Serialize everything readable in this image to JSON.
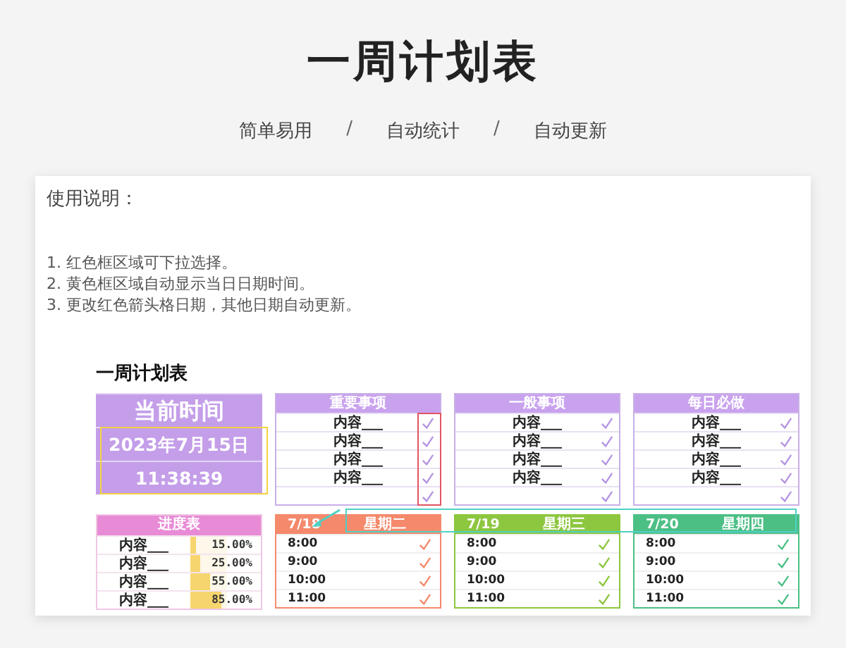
{
  "page": {
    "title": "一周计划表",
    "subtitle": [
      {
        "kind": "tag",
        "text": "简单易用"
      },
      {
        "kind": "separator",
        "text": "/"
      },
      {
        "kind": "tag",
        "text": "自动统计"
      },
      {
        "kind": "separator",
        "text": "/"
      },
      {
        "kind": "tag",
        "text": "自动更新"
      }
    ]
  },
  "instructions": {
    "heading": "使用说明：",
    "steps": [
      "1. 红色框区域可下拉选择。",
      "2. 黄色框区域自动显示当日日期时间。",
      "3. 更改红色箭头格日期，其他日期自动更新。"
    ]
  },
  "sheet": {
    "title": "一周计划表",
    "clock": {
      "heading": "当前时间",
      "date": "2023年7月15日",
      "time": "11:38:39"
    },
    "progress": {
      "heading": "进度表",
      "rows": [
        {
          "item": "内容___",
          "level": 0.15,
          "percent": "15.00%"
        },
        {
          "item": "内容___",
          "level": 0.25,
          "percent": "25.00%"
        },
        {
          "item": "内容___",
          "level": 0.55,
          "percent": "55.00%"
        },
        {
          "item": "内容___",
          "level": 0.85,
          "percent": "85.00%"
        }
      ]
    },
    "lists": [
      {
        "heading": "重要事项",
        "highlight": true,
        "rows": [
          {
            "text": "内容___",
            "checked": true
          },
          {
            "text": "内容___",
            "checked": true
          },
          {
            "text": "内容___",
            "checked": true
          },
          {
            "text": "内容___",
            "checked": true
          },
          {
            "checked": true
          }
        ]
      },
      {
        "heading": "一般事项",
        "highlight": false,
        "rows": [
          {
            "text": "内容___",
            "checked": true
          },
          {
            "text": "内容___",
            "checked": true
          },
          {
            "text": "内容___",
            "checked": true
          },
          {
            "text": "内容___",
            "checked": true
          },
          {
            "checked": true
          }
        ]
      },
      {
        "heading": "每日必做",
        "highlight": false,
        "rows": [
          {
            "text": "内容___",
            "checked": true
          },
          {
            "text": "内容___",
            "checked": true
          },
          {
            "text": "内容___",
            "checked": true
          },
          {
            "text": "内容___",
            "checked": true
          },
          {
            "checked": true
          }
        ]
      }
    ],
    "days": [
      {
        "date": "7/18",
        "weekday": "星期二",
        "color": "#f4896b",
        "rows": [
          {
            "time": "8:00",
            "checked": true
          },
          {
            "time": "9:00",
            "checked": true
          },
          {
            "time": "10:00",
            "checked": true
          },
          {
            "time": "11:00",
            "checked": true
          }
        ]
      },
      {
        "date": "7/19",
        "weekday": "星期三",
        "color": "#8dc63f",
        "rows": [
          {
            "time": "8:00",
            "checked": true
          },
          {
            "time": "9:00",
            "checked": true
          },
          {
            "time": "10:00",
            "checked": true
          },
          {
            "time": "11:00",
            "checked": true
          }
        ]
      },
      {
        "date": "7/20",
        "weekday": "星期四",
        "color": "#4cbf85",
        "rows": [
          {
            "time": "8:00",
            "checked": true
          },
          {
            "time": "9:00",
            "checked": true
          },
          {
            "time": "10:00",
            "checked": true
          },
          {
            "time": "11:00",
            "checked": true
          }
        ]
      }
    ]
  }
}
